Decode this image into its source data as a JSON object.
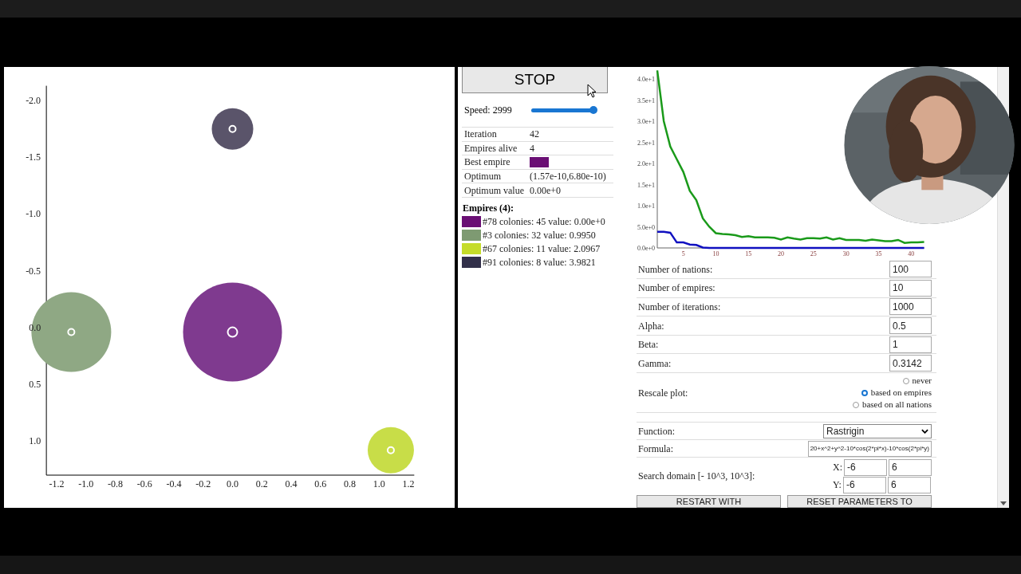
{
  "plot": {
    "chart_data": {
      "type": "scatter",
      "x": [
        0.0,
        -1.1,
        0.0,
        1.08
      ],
      "xlim": [
        -1.27,
        1.24
      ],
      "ylim": [
        1.3,
        -2.13
      ],
      "xticks": [
        {
          "value": -1.2,
          "label": "-1.2"
        },
        {
          "value": -1,
          "label": "-1.0"
        },
        {
          "value": -0.8,
          "label": "-0.8"
        },
        {
          "value": -0.6,
          "label": "-0.6"
        },
        {
          "value": -0.4,
          "label": "-0.4"
        },
        {
          "value": -0.2,
          "label": "-0.2"
        },
        {
          "value": 0,
          "label": "0.0"
        },
        {
          "value": 0.2,
          "label": "0.2"
        },
        {
          "value": 0.4,
          "label": "0.4"
        },
        {
          "value": 0.6,
          "label": "0.6"
        },
        {
          "value": 0.8,
          "label": "0.8"
        },
        {
          "value": 1,
          "label": "1.0"
        },
        {
          "value": 1.2,
          "label": "1.2"
        }
      ],
      "yticks": [
        {
          "value": -2,
          "label": "-2.0"
        },
        {
          "value": -1.5,
          "label": "-1.5"
        },
        {
          "value": -1,
          "label": "-1.0"
        },
        {
          "value": -0.5,
          "label": "-0.5"
        },
        {
          "value": 0,
          "label": "0.0"
        },
        {
          "value": 0.5,
          "label": "0.5"
        },
        {
          "value": 1,
          "label": "1.0"
        }
      ],
      "series": [
        {
          "color": "#7f3a8f",
          "values": [
            0.04,
            null,
            null,
            null
          ]
        },
        {
          "color": "#8fa884",
          "values": [
            null,
            0.04,
            null,
            null
          ]
        },
        {
          "color": "#c8dd48",
          "values": [
            null,
            null,
            null,
            1.08
          ]
        },
        {
          "color": "#5a546a",
          "values": [
            null,
            null,
            -1.75,
            null
          ]
        }
      ]
    }
  },
  "stop_button": "STOP",
  "speed": {
    "label": "Speed: 2999",
    "level": 0.97
  },
  "stats": [
    {
      "kind": "text",
      "label": "Iteration",
      "value": "42"
    },
    {
      "kind": "text",
      "label": "Empires alive",
      "value": "4"
    },
    {
      "kind": "swatch",
      "label": "Best empire",
      "color": "#6a0f74"
    },
    {
      "kind": "text",
      "label": "Optimum",
      "value": "(1.57e-10,6.80e-10)"
    },
    {
      "kind": "text",
      "label": "Optimum value",
      "value": "0.00e+0"
    }
  ],
  "empires": {
    "title": "Empires (4):",
    "items": [
      {
        "text": "#78 colonies: 45 value: 0.00e+0",
        "color": "#6a0f74"
      },
      {
        "text": "#3 colonies: 32 value: 0.9950",
        "color": "#7e9a72"
      },
      {
        "text": "#67 colonies: 11 value: 2.0967",
        "color": "#c5dc2a"
      },
      {
        "text": "#91 colonies: 8 value: 3.9821",
        "color": "#32304a"
      }
    ]
  },
  "convergence": {
    "chart_data": {
      "type": "line",
      "x": [
        1,
        2,
        3,
        4,
        5,
        6,
        7,
        8,
        9,
        10,
        11,
        12,
        13,
        14,
        15,
        16,
        17,
        18,
        19,
        20,
        21,
        22,
        23,
        24,
        25,
        26,
        27,
        28,
        29,
        30,
        31,
        32,
        33,
        34,
        35,
        36,
        37,
        38,
        39,
        40,
        41,
        42
      ],
      "xlim": [
        1,
        42
      ],
      "ylim": [
        0,
        42
      ],
      "xticks": [
        5,
        10,
        15,
        20,
        25,
        30,
        35,
        40
      ],
      "yticks": [
        {
          "value": 0,
          "label": "0.0e+0"
        },
        {
          "value": 5,
          "label": "5.0e+0"
        },
        {
          "value": 10,
          "label": "1.0e+1"
        },
        {
          "value": 15,
          "label": "1.5e+1"
        },
        {
          "value": 20,
          "label": "2.0e+1"
        },
        {
          "value": 25,
          "label": "2.5e+1"
        },
        {
          "value": 30,
          "label": "3.0e+1"
        },
        {
          "value": 35,
          "label": "3.5e+1"
        },
        {
          "value": 40,
          "label": "4.0e+1"
        }
      ],
      "series": [
        {
          "color": "#1a9a1a",
          "values": [
            42,
            30,
            24,
            21,
            18,
            13.5,
            11.3,
            7,
            5,
            3.5,
            3.3,
            3.2,
            3.0,
            2.6,
            2.8,
            2.5,
            2.5,
            2.5,
            2.4,
            2.0,
            2.5,
            2.2,
            2.0,
            2.3,
            2.3,
            2.2,
            2.5,
            2.0,
            2.3,
            1.9,
            1.9,
            1.9,
            1.7,
            2.0,
            1.8,
            1.6,
            1.6,
            1.9,
            1.2,
            1.3,
            1.3,
            1.4
          ]
        },
        {
          "color": "#1010c0",
          "values": [
            3.8,
            3.8,
            3.6,
            1.3,
            1.3,
            0.8,
            0.7,
            0.1,
            0,
            0,
            0,
            0,
            0,
            0,
            0,
            0,
            0,
            0,
            0,
            0,
            0,
            0,
            0,
            0,
            0,
            0,
            0,
            0,
            0,
            0,
            0,
            0,
            0,
            0,
            0,
            0,
            0,
            0,
            0,
            0,
            0,
            0
          ]
        }
      ]
    }
  },
  "webcam": {
    "kind": "picture"
  },
  "parameters": [
    {
      "label": "Number of nations:",
      "value": "100"
    },
    {
      "label": "Number of empires:",
      "value": "10"
    },
    {
      "label": "Number of iterations:",
      "value": "1000"
    },
    {
      "label": "Alpha:",
      "value": "0.5"
    },
    {
      "label": "Beta:",
      "value": "1"
    },
    {
      "label": "Gamma:",
      "value": "0.3142"
    }
  ],
  "rescale": {
    "label": "Rescale plot:",
    "options": [
      {
        "label": "never",
        "selected": false
      },
      {
        "label": "based on empires",
        "selected": true
      },
      {
        "label": "based on all nations",
        "selected": false
      }
    ]
  },
  "function": {
    "label": "Function:",
    "value": "Rastrigin"
  },
  "formula": {
    "label": "Formula:",
    "value": "20+x^2+y^2-10*cos(2*pi*x)-10*cos(2*pi*y)"
  },
  "domain": {
    "label": "Search domain [- 10^3, 10^3]:",
    "rows": [
      {
        "label": "X:",
        "min": "-6",
        "max": "6"
      },
      {
        "label": "Y:",
        "min": "-6",
        "max": "6"
      }
    ]
  },
  "buttons": [
    "RESTART WITH",
    "RESET PARAMETERS TO"
  ]
}
